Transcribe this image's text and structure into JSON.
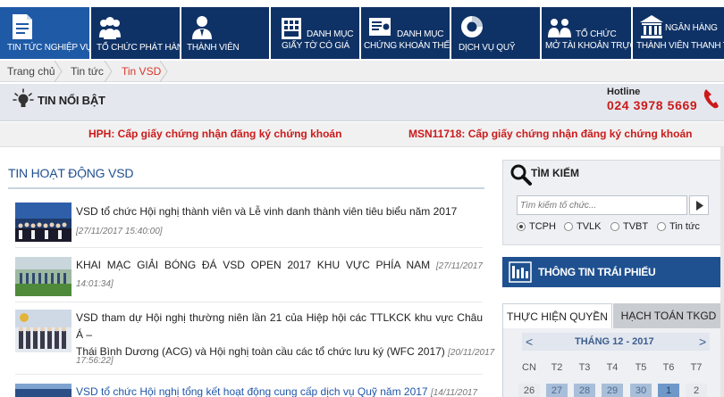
{
  "nav": [
    {
      "label": "Tin tức nghiệp vụ",
      "icon": "document-icon"
    },
    {
      "label": "Tổ chức phát hành",
      "icon": "group-icon"
    },
    {
      "label": "Thành viên",
      "icon": "person-icon"
    },
    {
      "label_line1": "Danh mục",
      "label_line2": "giấy tờ có giá",
      "icon": "calculator-icon"
    },
    {
      "label_line1": "Danh mục",
      "label_line2": "chứng khoán thế chấp",
      "icon": "certificate-icon"
    },
    {
      "label": "Dịch vụ quỹ",
      "icon": "lifebuoy-icon"
    },
    {
      "label_line1": "Tổ chức",
      "label_line2": "mở tài khoản trực tiếp",
      "icon": "team-icon"
    },
    {
      "label_line1": "Ngân hàng",
      "label_line2": "thành viên thanh toán",
      "icon": "bank-icon"
    }
  ],
  "breadcrumb": [
    "Trang chủ",
    "Tin tức",
    "Tin VSD"
  ],
  "featured": {
    "title": "TIN NỔI BẬT"
  },
  "hotline": {
    "label": "Hotline",
    "number": "024 3978 5669"
  },
  "ticker": [
    "HPH: Cấp giấy chứng nhận đăng ký chứng khoán",
    "MSN11718: Cấp giấy chứng nhận đăng ký chứng khoán"
  ],
  "news_section": {
    "title": "Tin hoạt động VSD"
  },
  "news": [
    {
      "title": "VSD tổ chức Hội nghị thành viên và Lễ vinh danh thành viên tiêu biểu năm 2017",
      "date": "[27/11/2017 15:40:00]"
    },
    {
      "title": "KHAI MẠC GIẢI BÓNG ĐÁ VSD OPEN 2017 KHU VỰC PHÍA NAM",
      "date": "[27/11/2017 14:01:34]"
    },
    {
      "title_line1": "VSD tham dự Hội nghị thường niên lần 21 của Hiệp hội các TTLKCK khu vực Châu Á –",
      "title_line2": "Thái Bình Dương (ACG) và Hội nghị toàn cầu các tổ chức lưu ký (WFC 2017)",
      "date_part1": "[20/11/2017",
      "date_part2": "17:56:22]"
    },
    {
      "title": "VSD tổ chức Hội nghị tổng kết hoạt động cung cấp dịch vụ Quỹ năm 2017",
      "date": "[14/11/2017"
    }
  ],
  "search": {
    "title": "TÌM KIẾM",
    "placeholder": "Tìm kiếm tổ chức...",
    "options": [
      "TCPH",
      "TVLK",
      "TVBT",
      "Tin tức"
    ],
    "selected": "TCPH"
  },
  "bond_banner": {
    "label": "THÔNG TIN TRÁI PHIẾU"
  },
  "tabs": [
    "THỰC HIỆN QUYỀN",
    "HẠCH TOÁN TKGD"
  ],
  "calendar": {
    "month": "THÁNG 12 - 2017",
    "prev": "<",
    "next": ">",
    "dow": [
      "CN",
      "T2",
      "T3",
      "T4",
      "T5",
      "T6",
      "T7"
    ],
    "week1": [
      "26",
      "27",
      "28",
      "29",
      "30",
      "1",
      "2"
    ]
  },
  "colors": {
    "nav_active": "#1f5aa6",
    "nav_dark": "#0f3266",
    "accent_red": "#cc1a1a",
    "link_blue": "#1f4f8f"
  }
}
